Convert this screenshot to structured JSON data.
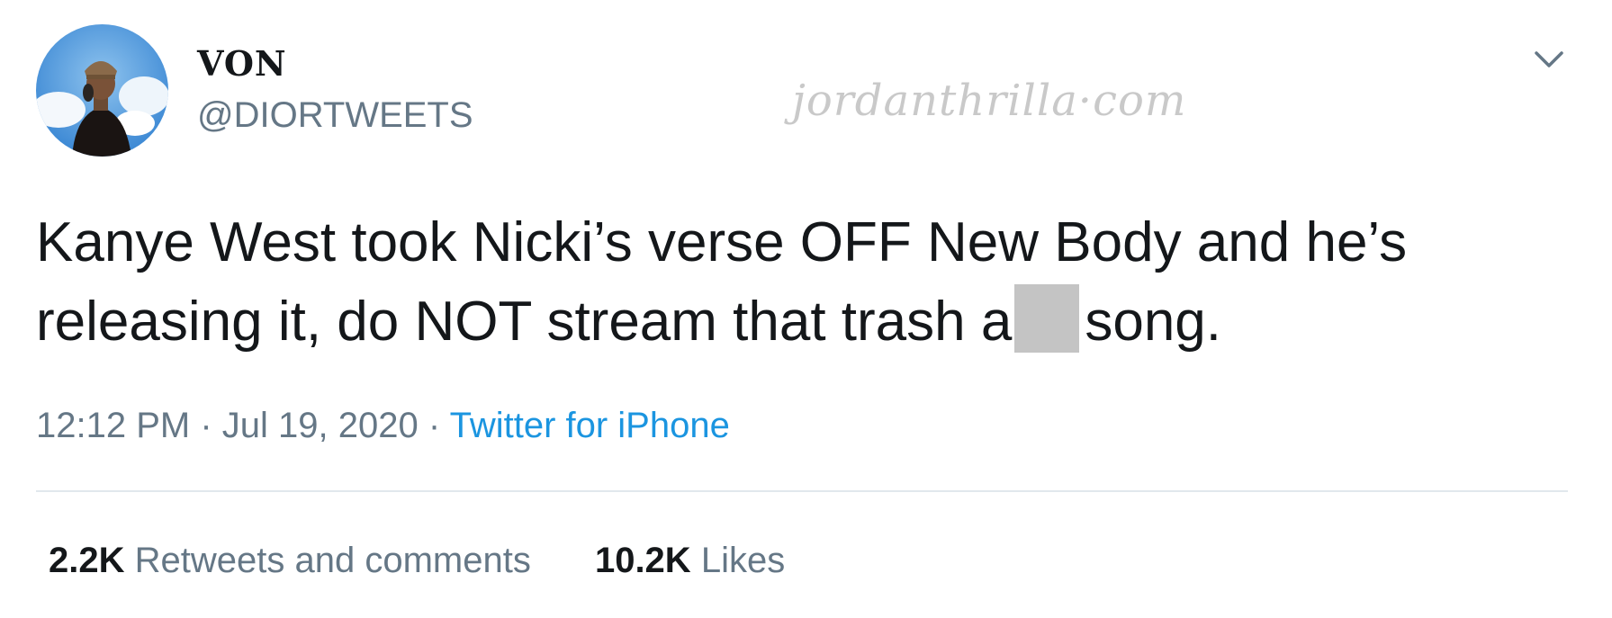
{
  "user": {
    "display_name": "VON",
    "handle": "@DIORTWEETS"
  },
  "watermark": "jordanthrilla·com",
  "tweet": {
    "text_part1": "Kanye West took Nicki’s verse OFF New Body and he’s releasing it, do NOT stream that trash a",
    "text_part2": "song.",
    "time": "12:12 PM",
    "date": "Jul 19, 2020",
    "separator": "·",
    "source": "Twitter for iPhone"
  },
  "stats": {
    "retweets_count": "2.2K",
    "retweets_label": "Retweets and comments",
    "likes_count": "10.2K",
    "likes_label": "Likes"
  },
  "icons": {
    "menu": "chevron-down-icon",
    "avatar": "profile-photo"
  },
  "colors": {
    "link": "#1b95e0",
    "secondary_text": "#657786",
    "primary_text": "#14171a",
    "divider": "#e1e8ed",
    "redaction": "#c4c4c4"
  }
}
